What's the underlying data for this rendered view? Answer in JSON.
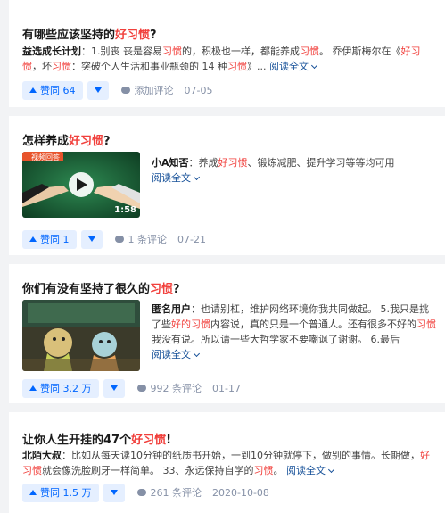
{
  "cards": [
    {
      "title_pre": "有哪些应该坚持的",
      "title_hl": "好习惯",
      "title_post": "?",
      "author": "益选成长计划",
      "excerpt_parts": [
        {
          "t": "：1.别丧 丧是容易",
          "hl": false
        },
        {
          "t": "习惯",
          "hl": true
        },
        {
          "t": "的，积极也一样，都能养成",
          "hl": false
        },
        {
          "t": "习惯",
          "hl": true
        },
        {
          "t": "。 乔伊斯梅尔在《",
          "hl": false
        },
        {
          "t": "好习惯",
          "hl": true
        },
        {
          "t": "，坏",
          "hl": false
        },
        {
          "t": "习惯",
          "hl": true
        },
        {
          "t": "：突破个人生活和事业瓶颈的 14 种",
          "hl": false
        },
        {
          "t": "习惯",
          "hl": true
        },
        {
          "t": "》... ",
          "hl": false
        }
      ],
      "read_more": "阅读全文",
      "vote_label": "赞同 64",
      "comment_label": "添加评论",
      "date": "07-05"
    },
    {
      "title_pre": "怎样养成",
      "title_hl": "好习惯",
      "title_post": "?",
      "video_badge": "视频回答",
      "video_duration": "1:58",
      "author": "小A知否",
      "excerpt_parts": [
        {
          "t": "：养成",
          "hl": false
        },
        {
          "t": "好习惯",
          "hl": true
        },
        {
          "t": "、锻炼减肥、提升学习等等均可用 ",
          "hl": false
        }
      ],
      "read_more": "阅读全文",
      "vote_label": "赞同 1",
      "comment_label": "1 条评论",
      "date": "07-21"
    },
    {
      "title_pre": "你们有没有坚持了很久的",
      "title_hl": "习惯",
      "title_post": "?",
      "author": "匿名用户",
      "excerpt_parts": [
        {
          "t": "：也请别杠，维护网络环境你我共同做起。 5.我只是挑了些",
          "hl": false
        },
        {
          "t": "好的习惯",
          "hl": true
        },
        {
          "t": "内容说，真的只是一个普通人。还有很多不好的",
          "hl": false
        },
        {
          "t": "习惯",
          "hl": true
        },
        {
          "t": "我没有说。所以请一些大哲学家不要嘲讽了谢谢。 6.最后 ",
          "hl": false
        }
      ],
      "read_more": "阅读全文",
      "vote_label": "赞同 3.2 万",
      "comment_label": "992 条评论",
      "date": "01-17"
    },
    {
      "title_pre": "让你人生开挂的47个",
      "title_hl": "好习惯",
      "title_post": "!",
      "author": "北陌大叔",
      "excerpt_parts": [
        {
          "t": "：比如从每天读10分钟的纸质书开始，一到10分钟就停下，做别的事情。长期做，",
          "hl": false
        },
        {
          "t": "好习惯",
          "hl": true
        },
        {
          "t": "就会像洗脸刷牙一样简单。 33、永远保持自学的",
          "hl": false
        },
        {
          "t": "习惯",
          "hl": true
        },
        {
          "t": "。 ",
          "hl": false
        }
      ],
      "read_more": "阅读全文",
      "vote_label": "赞同 1.5 万",
      "comment_label": "261 条评论",
      "date": "2020-10-08"
    }
  ],
  "colors": {
    "accent": "#0066ff",
    "highlight": "#f1403c",
    "link": "#175199"
  }
}
